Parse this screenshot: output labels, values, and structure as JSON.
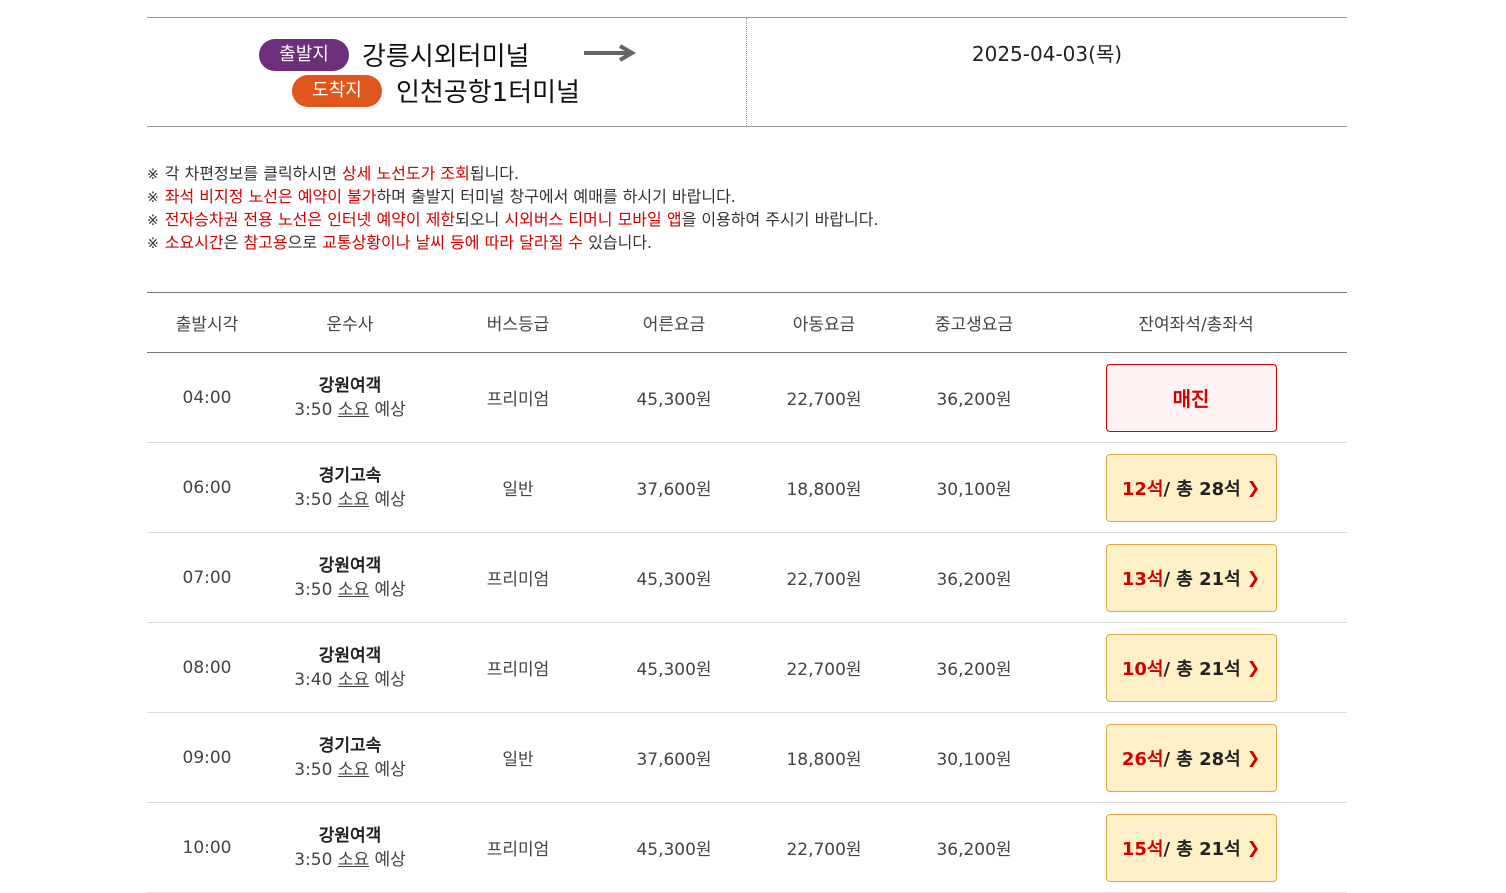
{
  "route": {
    "dep_label": "출발지",
    "dep_terminal": "강릉시외터미널",
    "arr_label": "도착지",
    "arr_terminal": "인천공항1터미널",
    "date": "2025-04-03(목)"
  },
  "notices": [
    {
      "mark": "※",
      "parts": [
        {
          "t": "각 차편정보를 클릭하시면 ",
          "red": false
        },
        {
          "t": "상세 노선도가 조회",
          "red": true
        },
        {
          "t": "됩니다.",
          "red": false
        }
      ]
    },
    {
      "mark": "※",
      "parts": [
        {
          "t": "좌석 비지정 노선은 예약이 불가",
          "red": true
        },
        {
          "t": "하며 출발지 터미널 창구에서 예매를 하시기 바랍니다.",
          "red": false
        }
      ]
    },
    {
      "mark": "※",
      "parts": [
        {
          "t": "전자승차권 전용 노선은 인터넷 예약이 제한",
          "red": true
        },
        {
          "t": "되오니 ",
          "red": false
        },
        {
          "t": "시외버스 티머니 모바일 앱",
          "red": true
        },
        {
          "t": "을 이용하여 주시기 바랍니다.",
          "red": false
        }
      ]
    },
    {
      "mark": "※",
      "parts": [
        {
          "t": "소요시간",
          "red": true
        },
        {
          "t": "은 ",
          "red": false
        },
        {
          "t": "참고용",
          "red": true
        },
        {
          "t": "으로 ",
          "red": false
        },
        {
          "t": "교통상황이나 날씨 등에 따라 달라질 수",
          "red": true
        },
        {
          "t": " 있습니다.",
          "red": false
        }
      ]
    }
  ],
  "headers": [
    "출발시각",
    "운수사",
    "버스등급",
    "어른요금",
    "아동요금",
    "중고생요금",
    "잔여좌석/총좌석"
  ],
  "rows": [
    {
      "time": "04:00",
      "company": "강원여객",
      "dur": "3:50",
      "dur_u": "소요",
      "dur_s": "예상",
      "grade": "프리미엄",
      "adult": "45,300원",
      "child": "22,700원",
      "youth": "36,200원",
      "soldout": true,
      "soldout_label": "매진"
    },
    {
      "time": "06:00",
      "company": "경기고속",
      "dur": "3:50",
      "dur_u": "소요",
      "dur_s": "예상",
      "grade": "일반",
      "adult": "37,600원",
      "child": "18,800원",
      "youth": "30,100원",
      "soldout": false,
      "remain": "12석",
      "total": "/ 총 28석"
    },
    {
      "time": "07:00",
      "company": "강원여객",
      "dur": "3:50",
      "dur_u": "소요",
      "dur_s": "예상",
      "grade": "프리미엄",
      "adult": "45,300원",
      "child": "22,700원",
      "youth": "36,200원",
      "soldout": false,
      "remain": "13석",
      "total": "/ 총 21석"
    },
    {
      "time": "08:00",
      "company": "강원여객",
      "dur": "3:40",
      "dur_u": "소요",
      "dur_s": "예상",
      "grade": "프리미엄",
      "adult": "45,300원",
      "child": "22,700원",
      "youth": "36,200원",
      "soldout": false,
      "remain": "10석",
      "total": "/ 총 21석"
    },
    {
      "time": "09:00",
      "company": "경기고속",
      "dur": "3:50",
      "dur_u": "소요",
      "dur_s": "예상",
      "grade": "일반",
      "adult": "37,600원",
      "child": "18,800원",
      "youth": "30,100원",
      "soldout": false,
      "remain": "26석",
      "total": "/ 총 28석"
    },
    {
      "time": "10:00",
      "company": "강원여객",
      "dur": "3:50",
      "dur_u": "소요",
      "dur_s": "예상",
      "grade": "프리미엄",
      "adult": "45,300원",
      "child": "22,700원",
      "youth": "36,200원",
      "soldout": false,
      "remain": "15석",
      "total": "/ 총 21석"
    }
  ],
  "icons": {
    "arrow": "arrow-right-icon",
    "chevron": "chevron-right-icon"
  }
}
